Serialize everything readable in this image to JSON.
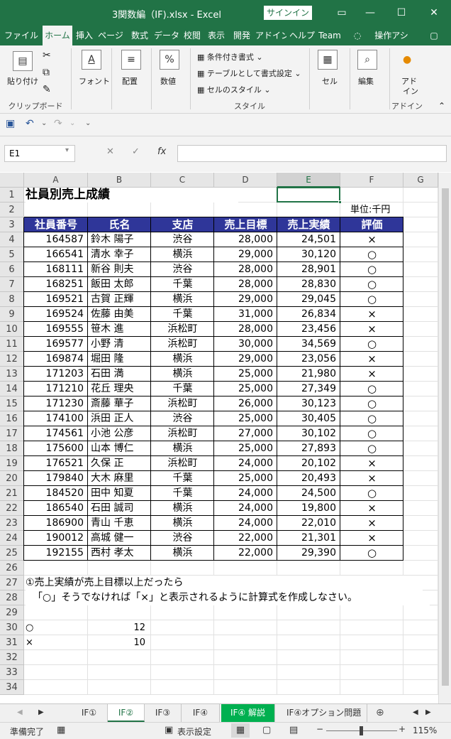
{
  "window": {
    "title": "3関数編（IF).xlsx  -  Excel",
    "signin": "サインイン",
    "minimize": "—",
    "restore": "☐",
    "close": "✕"
  },
  "ribbon_tabs": [
    "ファイル",
    "ホーム",
    "挿入",
    "ページ",
    "数式",
    "データ",
    "校閲",
    "表示",
    "開発",
    "アドイン",
    "ヘルプ",
    "Team",
    "操作アシ"
  ],
  "ribbon": {
    "clipboard": {
      "paste": "貼り付け",
      "group": "クリップボード"
    },
    "font": {
      "label": "フォント"
    },
    "alignment": {
      "label": "配置"
    },
    "number": {
      "label": "数値"
    },
    "styles": {
      "conditional": "条件付き書式",
      "table": "テーブルとして書式設定",
      "cell_styles": "セルのスタイル",
      "group": "スタイル"
    },
    "cells": {
      "label": "セル"
    },
    "editing": {
      "label": "編集"
    },
    "addin": {
      "label1": "アド",
      "label2": "イン",
      "group": "アドイン"
    }
  },
  "formula_bar": {
    "name_box": "E1",
    "fx": "fx",
    "value": ""
  },
  "columns": [
    "A",
    "B",
    "C",
    "D",
    "E",
    "F",
    "G"
  ],
  "selected_column": "E",
  "rows": [
    "1",
    "2",
    "3",
    "4",
    "5",
    "6",
    "7",
    "8",
    "9",
    "10",
    "11",
    "12",
    "13",
    "14",
    "15",
    "16",
    "17",
    "18",
    "19",
    "20",
    "21",
    "22",
    "23",
    "24",
    "25",
    "26",
    "27",
    "28",
    "29",
    "30",
    "31",
    "32",
    "33",
    "34"
  ],
  "sheet": {
    "title": "社員別売上成績",
    "unit": "単位:千円",
    "headers": [
      "社員番号",
      "氏名",
      "支店",
      "売上目標",
      "売上実績",
      "評価"
    ],
    "data": [
      [
        "164587",
        "鈴木 陽子",
        "渋谷",
        "28,000",
        "24,501",
        "×"
      ],
      [
        "166541",
        "清水 幸子",
        "横浜",
        "29,000",
        "30,120",
        "○"
      ],
      [
        "168111",
        "新谷 則夫",
        "渋谷",
        "28,000",
        "28,901",
        "○"
      ],
      [
        "168251",
        "飯田 太郎",
        "千葉",
        "28,000",
        "28,830",
        "○"
      ],
      [
        "169521",
        "古賀 正輝",
        "横浜",
        "29,000",
        "29,045",
        "○"
      ],
      [
        "169524",
        "佐藤 由美",
        "千葉",
        "31,000",
        "26,834",
        "×"
      ],
      [
        "169555",
        "笹木 進",
        "浜松町",
        "28,000",
        "23,456",
        "×"
      ],
      [
        "169577",
        "小野 清",
        "浜松町",
        "30,000",
        "34,569",
        "○"
      ],
      [
        "169874",
        "堀田 隆",
        "横浜",
        "29,000",
        "23,056",
        "×"
      ],
      [
        "171203",
        "石田 満",
        "横浜",
        "25,000",
        "21,980",
        "×"
      ],
      [
        "171210",
        "花丘 理央",
        "千葉",
        "25,000",
        "27,349",
        "○"
      ],
      [
        "171230",
        "斎藤 華子",
        "浜松町",
        "26,000",
        "30,123",
        "○"
      ],
      [
        "174100",
        "浜田 正人",
        "渋谷",
        "25,000",
        "30,405",
        "○"
      ],
      [
        "174561",
        "小池 公彦",
        "浜松町",
        "27,000",
        "30,102",
        "○"
      ],
      [
        "175600",
        "山本 博仁",
        "横浜",
        "25,000",
        "27,893",
        "○"
      ],
      [
        "176521",
        "久保 正",
        "浜松町",
        "24,000",
        "20,102",
        "×"
      ],
      [
        "179840",
        "大木 麻里",
        "千葉",
        "25,000",
        "20,493",
        "×"
      ],
      [
        "184520",
        "田中 知夏",
        "千葉",
        "24,000",
        "24,500",
        "○"
      ],
      [
        "186540",
        "石田 誠司",
        "横浜",
        "24,000",
        "19,800",
        "×"
      ],
      [
        "186900",
        "青山 千恵",
        "横浜",
        "24,000",
        "22,010",
        "×"
      ],
      [
        "190012",
        "高城 健一",
        "渋谷",
        "22,000",
        "21,301",
        "×"
      ],
      [
        "192155",
        "西村 孝太",
        "横浜",
        "22,000",
        "29,390",
        "○"
      ]
    ],
    "instruction1": "①売上実績が売上目標以上だったら",
    "instruction2": "「○」そうでなければ「×」と表示されるように計算式を作成しなさい。",
    "count_circle_label": "○",
    "count_circle": "12",
    "count_cross_label": "×",
    "count_cross": "10"
  },
  "sheet_tabs": [
    "IF①",
    "IF②",
    "IF③",
    "IF④",
    "IF④ 解説",
    "IF④オプション問題"
  ],
  "active_sheet": "IF②",
  "status": {
    "ready": "準備完了",
    "display_settings": "表示設定",
    "zoom": "115%"
  }
}
